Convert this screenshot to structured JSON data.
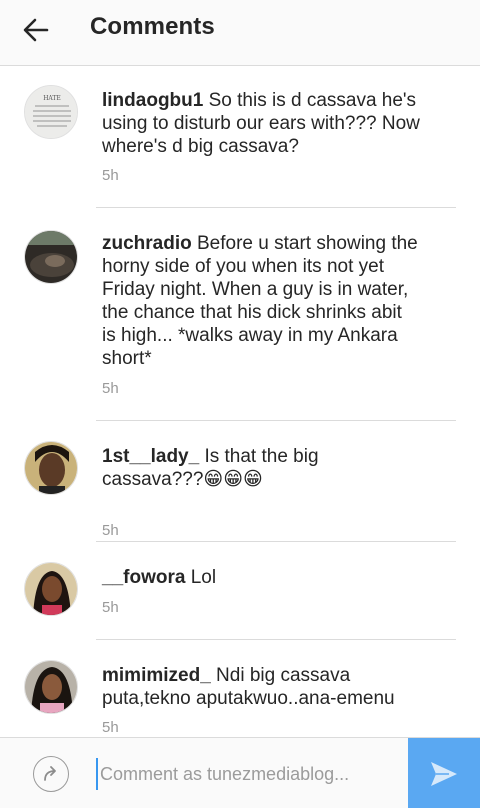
{
  "header": {
    "title": "Comments",
    "back_icon": "arrow-left-icon"
  },
  "comments": [
    {
      "username": "lindaogbu1",
      "text": " So this is d cassava he's using to disturb our ears with??? Now where's d big cassava?",
      "time": "5h",
      "avatar_caption": "HATE",
      "avatar_body": "ENERGY CAUSES A LOT OF PROBLEMS IN THE WORLD. BUT IF YOU HATE SOMEONE, DON'T."
    },
    {
      "username": "zuchradio",
      "text": " Before u start showing the horny side of you when its not yet Friday night. When a guy is in water, the chance that his dick shrinks abit is high... *walks away in my Ankara short*",
      "time": "5h"
    },
    {
      "username": "1st__lady_",
      "text": " Is that the big cassava???😁😁😁",
      "time": "5h"
    },
    {
      "username": "__fowora",
      "text": " Lol",
      "time": "5h"
    },
    {
      "username": "mimimized_",
      "text": " Ndi big cassava puta,tekno aputakwuo..ana-emenu",
      "time": "5h"
    }
  ],
  "footer": {
    "placeholder": "Comment as tunezmediablog...",
    "share_icon": "share-arrow-icon",
    "send_icon": "send-icon"
  },
  "colors": {
    "accent": "#5aa8f2",
    "divider": "#dbdbdb",
    "muted": "#999999"
  }
}
